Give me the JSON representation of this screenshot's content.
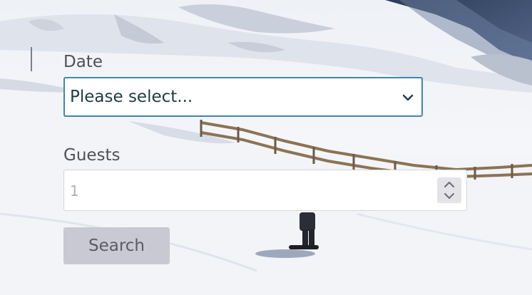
{
  "form": {
    "date_label": "Date",
    "date_select_value": "Please select...",
    "guests_label": "Guests",
    "guests_placeholder": "1",
    "search_label": "Search"
  },
  "colors": {
    "select_border": "#3e86b2",
    "button_bg": "#c5c5d0",
    "label_text": "#4f5157"
  },
  "icons": {
    "select_chevron": "chevron-down-icon",
    "spinner_up": "chevron-up-icon",
    "spinner_down": "chevron-down-icon"
  }
}
